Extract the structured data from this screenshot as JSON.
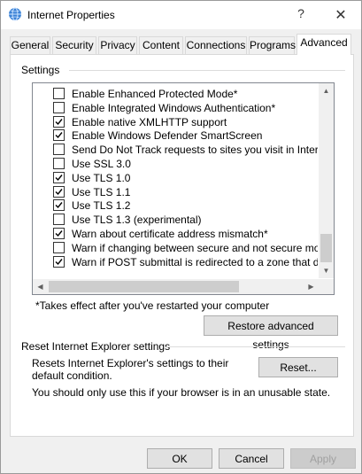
{
  "window": {
    "title": "Internet Properties",
    "help_glyph": "?",
    "close_glyph": "✕"
  },
  "tabs": [
    {
      "label": "General"
    },
    {
      "label": "Security"
    },
    {
      "label": "Privacy"
    },
    {
      "label": "Content"
    },
    {
      "label": "Connections"
    },
    {
      "label": "Programs"
    },
    {
      "label": "Advanced",
      "active": true
    }
  ],
  "settings": {
    "group_label": "Settings",
    "items": [
      {
        "label": "Enable Enhanced Protected Mode*",
        "checked": false
      },
      {
        "label": "Enable Integrated Windows Authentication*",
        "checked": false
      },
      {
        "label": "Enable native XMLHTTP support",
        "checked": true
      },
      {
        "label": "Enable Windows Defender SmartScreen",
        "checked": true
      },
      {
        "label": "Send Do Not Track requests to sites you visit in Internet E",
        "checked": false
      },
      {
        "label": "Use SSL 3.0",
        "checked": false
      },
      {
        "label": "Use TLS 1.0",
        "checked": true
      },
      {
        "label": "Use TLS 1.1",
        "checked": true
      },
      {
        "label": "Use TLS 1.2",
        "checked": true
      },
      {
        "label": "Use TLS 1.3 (experimental)",
        "checked": false
      },
      {
        "label": "Warn about certificate address mismatch*",
        "checked": true
      },
      {
        "label": "Warn if changing between secure and not secure mode",
        "checked": false
      },
      {
        "label": "Warn if POST submittal is redirected to a zone that does n",
        "checked": true
      }
    ],
    "restart_note": "*Takes effect after you've restarted your computer",
    "restore_button": "Restore advanced settings"
  },
  "reset": {
    "group_label": "Reset Internet Explorer settings",
    "description": "Resets Internet Explorer's settings to their default condition.",
    "button": "Reset...",
    "warning": "You should only use this if your browser is in an unusable state."
  },
  "footer": {
    "ok": "OK",
    "cancel": "Cancel",
    "apply": "Apply"
  },
  "colors": {
    "accent": "#0078d7",
    "check": "#000000"
  }
}
